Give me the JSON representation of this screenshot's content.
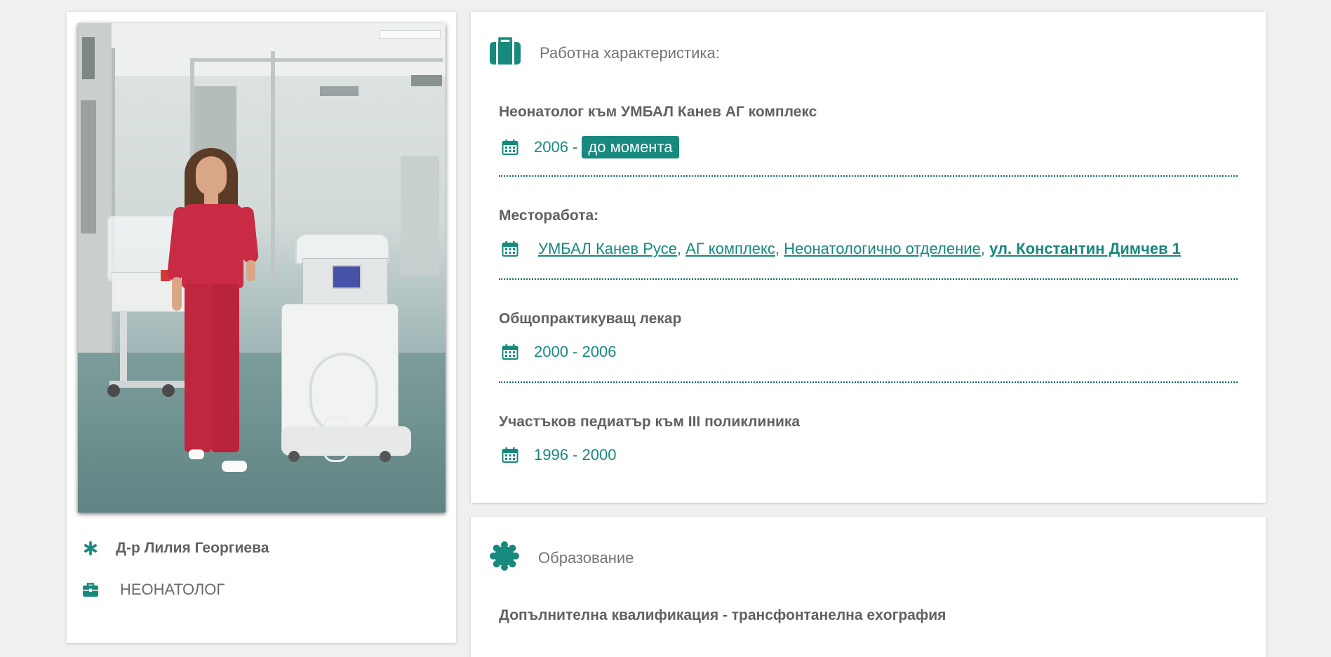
{
  "profile": {
    "name": "Д-р Лилия Георгиева",
    "specialty": "НЕОНАТОЛОГ"
  },
  "work": {
    "section_title": "Работна характеристика:",
    "entries": [
      {
        "title": "Неонатолог към УМБАЛ Канев АГ комплекс",
        "years": "2006 -",
        "current_badge": "до момента"
      },
      {
        "title": "Месторабота:",
        "links": [
          "УМБАЛ Канев Русе",
          "АГ комплекс",
          "Неонатологично отделение"
        ],
        "address": "ул. Константин Димчев 1"
      },
      {
        "title": "Общопрактикуващ лекар",
        "years": "2000 - 2006"
      },
      {
        "title": "Участъков педиатър към III поликлиника",
        "years": "1996 - 2000"
      }
    ]
  },
  "education": {
    "section_title": "Образование",
    "entries": [
      {
        "title": "Допълнителна квалификация - трансфонтанелна exография"
      }
    ]
  },
  "colors": {
    "accent": "#17897d",
    "background": "#f0f0f0",
    "card": "#ffffff"
  }
}
